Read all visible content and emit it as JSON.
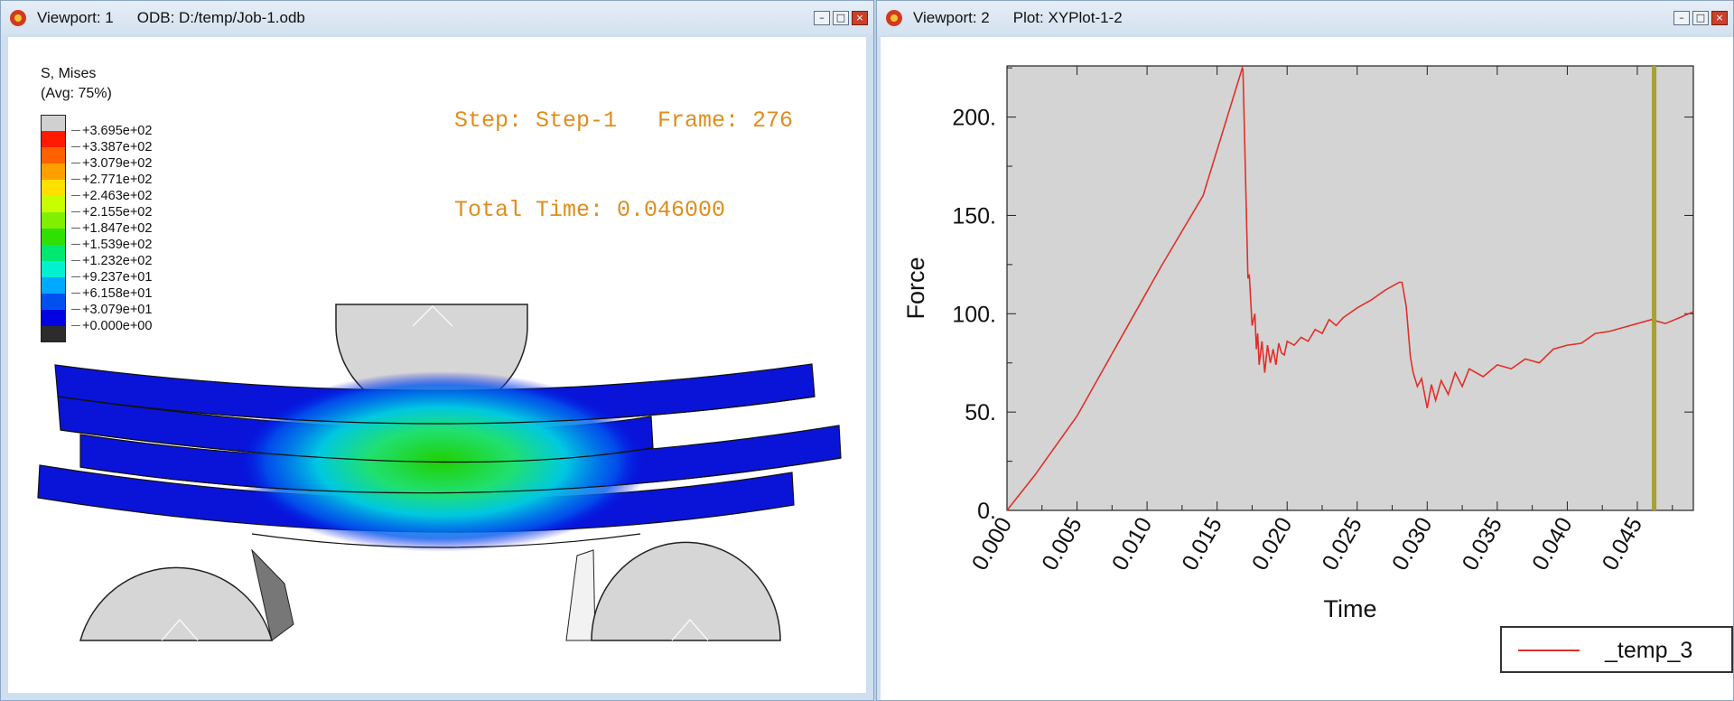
{
  "viewport1": {
    "title": "Viewport: 1",
    "odb": "ODB: D:/temp/Job-1.odb",
    "buttons": {
      "minimize": "–",
      "maximize": "□",
      "close": "×"
    },
    "legend": {
      "field": "S, Mises",
      "averaging": "(Avg: 75%)",
      "levels": [
        "+3.695e+02",
        "+3.387e+02",
        "+3.079e+02",
        "+2.771e+02",
        "+2.463e+02",
        "+2.155e+02",
        "+1.847e+02",
        "+1.539e+02",
        "+1.232e+02",
        "+9.237e+01",
        "+6.158e+01",
        "+3.079e+01",
        "+0.000e+00"
      ],
      "colors": [
        "#d0d0d0",
        "#ff1a00",
        "#ff6000",
        "#ffa000",
        "#ffe000",
        "#c8ff00",
        "#80f000",
        "#30e000",
        "#00e870",
        "#00f0d0",
        "#00a8ff",
        "#0050f0",
        "#0000e0",
        "#2c2c2c"
      ]
    },
    "status": {
      "step_line": "Step: Step-1   Frame: 276",
      "time_line": "Total Time: 0.046000"
    }
  },
  "viewport2": {
    "title": "Viewport: 2",
    "plot": "Plot: XYPlot-1-2",
    "buttons": {
      "minimize": "–",
      "maximize": "□",
      "close": "×"
    },
    "legend_entry": "_temp_3"
  },
  "chart_data": {
    "type": "line",
    "xlabel": "Time",
    "ylabel": "Force",
    "xlim": [
      0,
      0.049
    ],
    "ylim": [
      0,
      226
    ],
    "xticks": [
      "0.000",
      "0.005",
      "0.010",
      "0.015",
      "0.020",
      "0.025",
      "0.030",
      "0.035",
      "0.040",
      "0.045"
    ],
    "yticks": [
      "0.",
      "50.",
      "100.",
      "150.",
      "200."
    ],
    "marker_x": 0.0462,
    "series": [
      {
        "name": "_temp_3",
        "color": "#e0302a",
        "x": [
          0,
          0.002,
          0.005,
          0.008,
          0.011,
          0.014,
          0.0168,
          0.01685,
          0.0172,
          0.0173,
          0.0175,
          0.0177,
          0.0178,
          0.0179,
          0.018,
          0.0182,
          0.0184,
          0.0186,
          0.0188,
          0.019,
          0.0192,
          0.0194,
          0.0196,
          0.0198,
          0.02,
          0.0205,
          0.021,
          0.0215,
          0.022,
          0.0225,
          0.023,
          0.0235,
          0.024,
          0.025,
          0.026,
          0.027,
          0.028,
          0.0282,
          0.0285,
          0.0288,
          0.029,
          0.0293,
          0.0296,
          0.03,
          0.0303,
          0.0306,
          0.031,
          0.0315,
          0.032,
          0.0325,
          0.033,
          0.034,
          0.035,
          0.036,
          0.037,
          0.038,
          0.039,
          0.04,
          0.041,
          0.042,
          0.043,
          0.044,
          0.045,
          0.046,
          0.047,
          0.048,
          0.049
        ],
        "y": [
          0,
          18,
          48,
          86,
          124,
          160,
          225,
          224,
          118,
          120,
          94,
          100,
          82,
          90,
          74,
          86,
          70,
          84,
          75,
          82,
          74,
          85,
          80,
          79,
          86,
          84,
          88,
          86,
          92,
          90,
          97,
          94,
          98,
          103,
          107,
          112,
          116,
          116,
          104,
          78,
          70,
          63,
          67,
          52,
          64,
          56,
          66,
          59,
          70,
          63,
          72,
          68,
          74,
          72,
          77,
          75,
          82,
          84,
          85,
          90,
          91,
          93,
          95,
          97,
          95,
          98,
          101
        ]
      }
    ]
  }
}
